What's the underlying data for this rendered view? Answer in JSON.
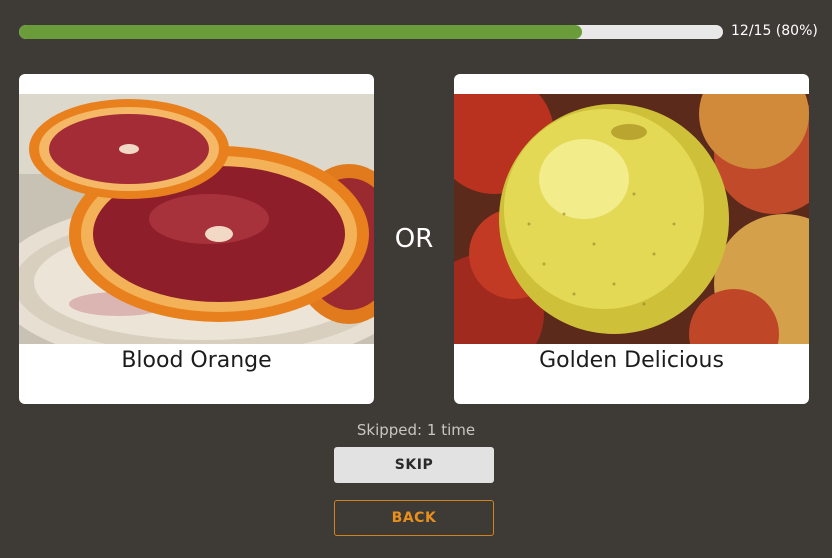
{
  "progress": {
    "fraction": 0.8,
    "label": "12/15 (80%)",
    "fill_color": "#6a9c3a"
  },
  "choices": [
    {
      "label": "Blood Orange",
      "image": "blood-orange-slices"
    },
    {
      "label": "Golden Delicious",
      "image": "yellow-apple"
    }
  ],
  "or_label": "OR",
  "skip_count_text": "Skipped: 1 time",
  "buttons": {
    "skip": "SKIP",
    "back": "BACK"
  },
  "colors": {
    "background": "#3e3a36",
    "accent": "#e9901c"
  }
}
